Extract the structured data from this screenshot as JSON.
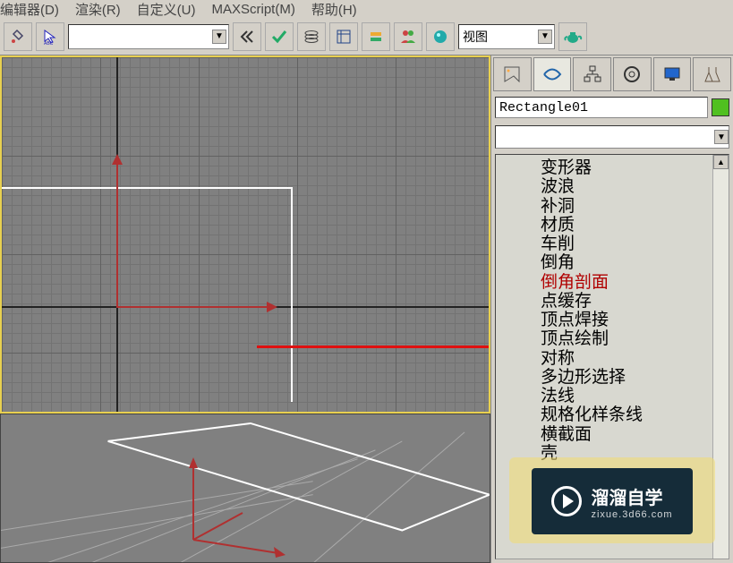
{
  "menu": {
    "editors": "编辑器(D)",
    "render": "渲染(R)",
    "customize": "自定义(U)",
    "maxscript": "MAXScript(M)",
    "help": "帮助(H)"
  },
  "toolbar": {
    "layer_dropdown": "",
    "view_dropdown": "视图"
  },
  "object": {
    "name": "Rectangle01"
  },
  "modifiers": [
    "变形器",
    "波浪",
    "补洞",
    "材质",
    "车削",
    "倒角",
    "倒角剖面",
    "点缓存",
    "顶点焊接",
    "顶点绘制",
    "对称",
    "多边形选择",
    "法线",
    "规格化样条线",
    "横截面",
    "壳"
  ],
  "highlighted_modifier_index": 6,
  "watermark": {
    "title": "溜溜自学",
    "sub": "zixue.3d66.com"
  }
}
